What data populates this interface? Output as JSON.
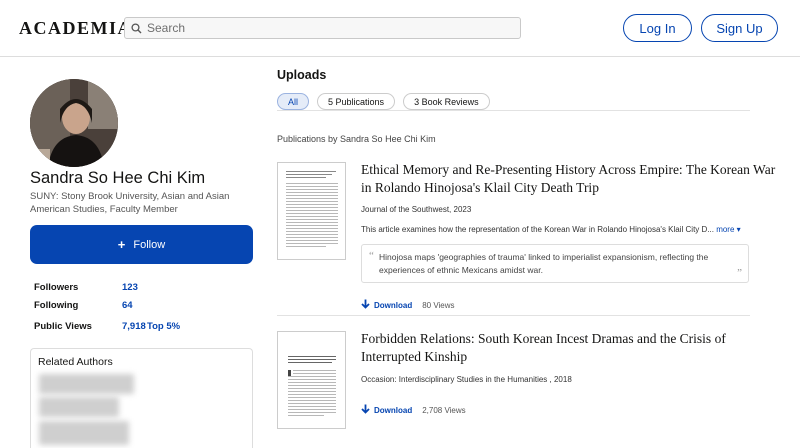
{
  "header": {
    "logo": "ACADEMIA",
    "search_placeholder": "Search",
    "login_label": "Log In",
    "signup_label": "Sign Up"
  },
  "profile": {
    "name": "Sandra So Hee Chi Kim",
    "affiliation": "SUNY: Stony Brook University, Asian and Asian American Studies, Faculty Member",
    "follow_label": "Follow",
    "stats": [
      {
        "label": "Followers",
        "value": "123"
      },
      {
        "label": "Following",
        "value": "64"
      },
      {
        "label": "Public Views",
        "value": "7,918",
        "extra": "Top 5%"
      }
    ],
    "related_title": "Related Authors"
  },
  "uploads": {
    "title": "Uploads",
    "tabs": [
      "All",
      "5 Publications",
      "3 Book Reviews"
    ],
    "active_tab": "All",
    "publications_by": "Publications by Sandra So Hee Chi Kim",
    "items": [
      {
        "title": "Ethical Memory and Re-Presenting History Across Empire: The Korean War in Rolando Hinojosa's Klail City Death Trip",
        "journal": "Journal of the Southwest, 2023",
        "abstract": "This article examines how the representation of the Korean War in Rolando Hinojosa's Klail City D...",
        "more_label": "more",
        "quote": "Hinojosa maps 'geographies of trauma' linked to imperialist expansionism, reflecting the experiences of ethnic Mexicans amidst war.",
        "download_label": "Download",
        "views": "80 Views"
      },
      {
        "title": "Forbidden Relations: South Korean Incest Dramas and the Crisis of Interrupted Kinship",
        "journal": "Occasion: Interdisciplinary Studies in the Humanities , 2018",
        "download_label": "Download",
        "views": "2,708 Views"
      }
    ]
  },
  "colors": {
    "brand_blue": "#0645b1",
    "text": "#141413",
    "border": "#dddddd"
  },
  "icons": {
    "search": "search-icon",
    "download": "download-icon",
    "quote": "quote-icon",
    "caret": "caret-down-icon",
    "plus": "plus-icon"
  }
}
